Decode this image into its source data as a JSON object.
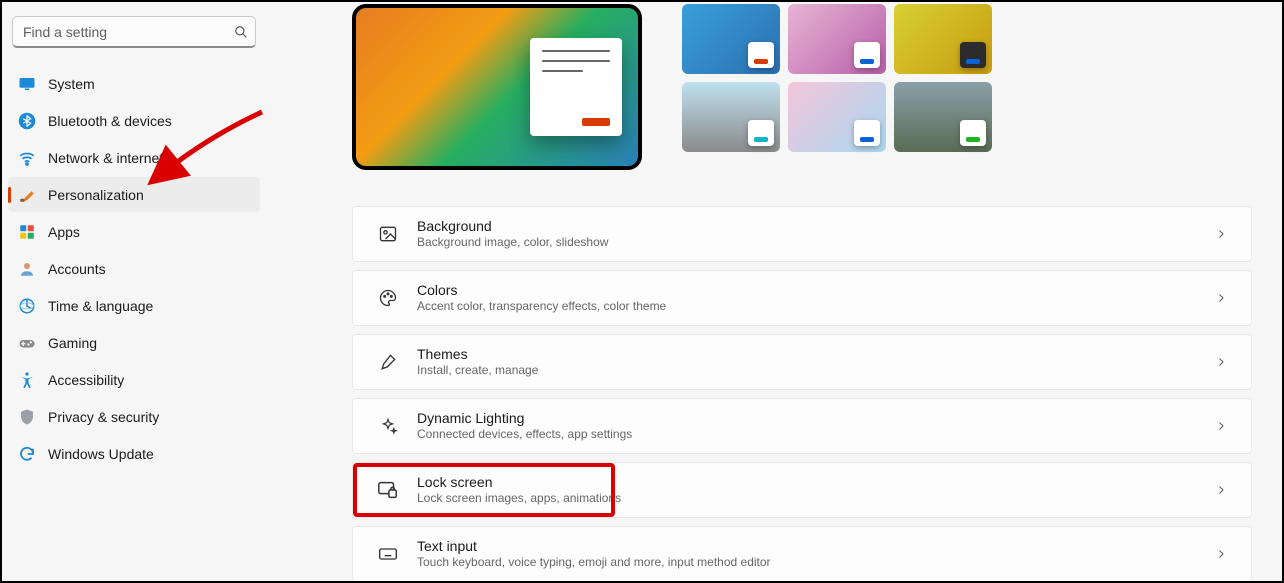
{
  "search": {
    "placeholder": "Find a setting"
  },
  "sidebar": {
    "selected_index": 3,
    "items": [
      {
        "label": "System",
        "icon": "💻"
      },
      {
        "label": "Bluetooth & devices",
        "icon": "bt"
      },
      {
        "label": "Network & internet",
        "icon": "🛜"
      },
      {
        "label": "Personalization",
        "icon": "🖌️"
      },
      {
        "label": "Apps",
        "icon": "apps"
      },
      {
        "label": "Accounts",
        "icon": "👤"
      },
      {
        "label": "Time & language",
        "icon": "🌐"
      },
      {
        "label": "Gaming",
        "icon": "🎮"
      },
      {
        "label": "Accessibility",
        "icon": "acc"
      },
      {
        "label": "Privacy & security",
        "icon": "🛡️"
      },
      {
        "label": "Windows Update",
        "icon": "🔄"
      }
    ]
  },
  "themes": [
    {
      "accent": "#d83b01",
      "bg": "linear-gradient(135deg,#3aa0d8,#2a6fb0)",
      "mode": "light"
    },
    {
      "accent": "#0b62d6",
      "bg": "linear-gradient(135deg,#e8b4d4,#b75fa8)",
      "mode": "light"
    },
    {
      "accent": "#0b62d6",
      "bg": "linear-gradient(135deg,#d8d034,#c79b10)",
      "mode": "dark"
    },
    {
      "accent": "#13b3c9",
      "bg": "linear-gradient(#bfe1ef,#8a8a8a)",
      "mode": "light"
    },
    {
      "accent": "#0b62d6",
      "bg": "linear-gradient(135deg,#f4c5da,#a9d8f0)",
      "mode": "light"
    },
    {
      "accent": "#1db51d",
      "bg": "linear-gradient(#8aa0a8,#5a6b55)",
      "mode": "light"
    }
  ],
  "settings_rows": [
    {
      "title": "Background",
      "sub": "Background image, color, slideshow",
      "icon": "image"
    },
    {
      "title": "Colors",
      "sub": "Accent color, transparency effects, color theme",
      "icon": "palette"
    },
    {
      "title": "Themes",
      "sub": "Install, create, manage",
      "icon": "brush"
    },
    {
      "title": "Dynamic Lighting",
      "sub": "Connected devices, effects, app settings",
      "icon": "sparkle"
    },
    {
      "title": "Lock screen",
      "sub": "Lock screen images, apps, animations",
      "icon": "lock-screen",
      "highlight": true
    },
    {
      "title": "Text input",
      "sub": "Touch keyboard, voice typing, emoji and more, input method editor",
      "icon": "keyboard"
    }
  ]
}
